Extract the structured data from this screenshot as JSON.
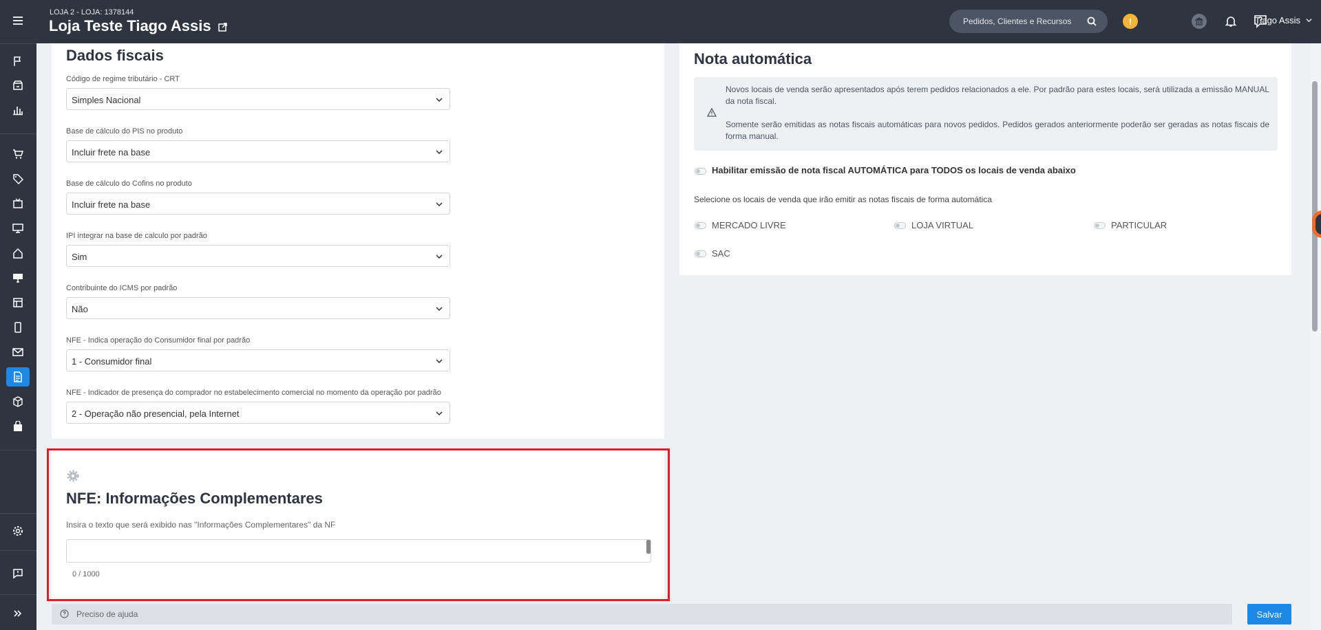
{
  "topbar": {
    "store_sub": "LOJA 2 - LOJA: 1378144",
    "store_title": "Loja Teste Tiago Assis",
    "search_placeholder": "Pedidos, Clientes e Recursos",
    "alert_badge": "!",
    "user_name": "Tiago Assis"
  },
  "sidebar": {
    "icons": [
      "menu-icon",
      "flag-icon",
      "store-icon",
      "bar-chart-icon",
      "cart-icon",
      "tag-icon",
      "tv-icon",
      "monitor-icon",
      "home-icon",
      "desktop-icon",
      "layout-icon",
      "mobile-icon",
      "mail-icon",
      "document-icon",
      "box-icon",
      "bag-icon",
      "gear-icon",
      "feedback-icon",
      "expand-icon"
    ],
    "active": "document-icon"
  },
  "fiscal": {
    "title": "Dados fiscais",
    "fields": [
      {
        "label": "Código de regime tributário - CRT",
        "value": "Simples Nacional"
      },
      {
        "label": "Base de cálculo do PIS no produto",
        "value": "Incluir frete na base"
      },
      {
        "label": "Base de cálculo do Cofins no produto",
        "value": "Incluir frete na base"
      },
      {
        "label": "IPI integrar na base de calculo por padrão",
        "value": "Sim"
      },
      {
        "label": "Contribuinte do ICMS por padrão",
        "value": "Não"
      },
      {
        "label": "NFE - Indica operação do Consumidor final por padrão",
        "value": "1 - Consumidor final"
      },
      {
        "label": "NFE - Indicador de presença do comprador no estabelecimento comercial no momento da operação por padrão",
        "value": "2 - Operação não presencial, pela Internet"
      }
    ]
  },
  "nfe_info": {
    "title": "NFE: Informações Complementares",
    "description": "Insira o texto que será exibido nas \"Informações Complementares\" da NF",
    "textarea_value": "",
    "counter": "0 / 1000"
  },
  "nota": {
    "title": "Nota automática",
    "info_1": "Novos locais de venda serão apresentados após terem pedidos relacionados a ele. Por padrão para estes locais, será utilizada a emissão MANUAL da nota fiscal.",
    "info_2": "Somente serão emitidas as notas fiscais automáticas para novos pedidos. Pedidos gerados anteriormente poderão ser geradas as notas fiscais de forma manual.",
    "enable_all_label": "Habilitar emissão de nota fiscal AUTOMÁTICA para TODOS os locais de venda abaixo",
    "select_label": "Selecione os locais de venda que irão emitir as notas fiscais de forma automática",
    "locations": [
      "MERCADO LIVRE",
      "LOJA VIRTUAL",
      "PARTICULAR",
      "SAC"
    ]
  },
  "footer": {
    "help": "Preciso de ajuda",
    "save": "Salvar"
  },
  "colors": {
    "sidebar": "#2e3440",
    "accent": "#1e88e5",
    "highlight": "#dc1f26",
    "alert": "#f4b43a"
  }
}
